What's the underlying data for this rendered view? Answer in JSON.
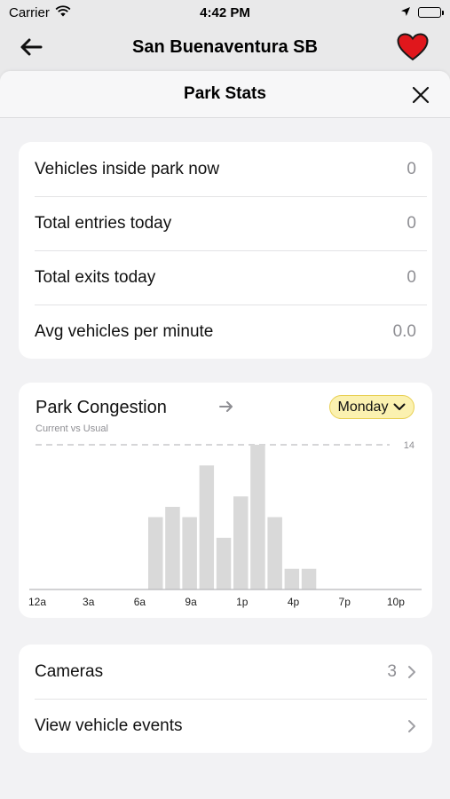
{
  "status_bar": {
    "carrier": "Carrier",
    "time": "4:42 PM"
  },
  "nav": {
    "title": "San Buenaventura SB",
    "favorite_color": "#e0171c"
  },
  "sheet": {
    "title": "Park Stats"
  },
  "stats": [
    {
      "label": "Vehicles inside park now",
      "value": "0"
    },
    {
      "label": "Total entries today",
      "value": "0"
    },
    {
      "label": "Total exits today",
      "value": "0"
    },
    {
      "label": "Avg vehicles per minute",
      "value": "0.0"
    }
  ],
  "congestion": {
    "title": "Park Congestion",
    "subtitle": "Current vs Usual",
    "day": "Monday",
    "accent": "#fbf1b0"
  },
  "chart_data": {
    "type": "bar",
    "max_label": "14",
    "x_tick_labels": [
      "12a",
      "3a",
      "6a",
      "9a",
      "1p",
      "4p",
      "7p",
      "10p"
    ],
    "categories": [
      "12a",
      "1a",
      "2a",
      "3a",
      "4a",
      "5a",
      "6a",
      "7a",
      "8a",
      "9a",
      "10a",
      "11a",
      "12p",
      "1p",
      "2p",
      "3p",
      "4p",
      "5p",
      "6p",
      "7p",
      "8p",
      "9p",
      "10p",
      "11p"
    ],
    "values": [
      0,
      0,
      0,
      0,
      0,
      0,
      0,
      7,
      8,
      7,
      12,
      5,
      9,
      14,
      7,
      2,
      2,
      0,
      0,
      0,
      0,
      0,
      0,
      0
    ],
    "ylim": [
      0,
      14
    ],
    "grid": false,
    "bar_color": "#d9d9d9"
  },
  "links": [
    {
      "label": "Cameras",
      "count": "3"
    },
    {
      "label": "View vehicle events",
      "count": ""
    }
  ]
}
